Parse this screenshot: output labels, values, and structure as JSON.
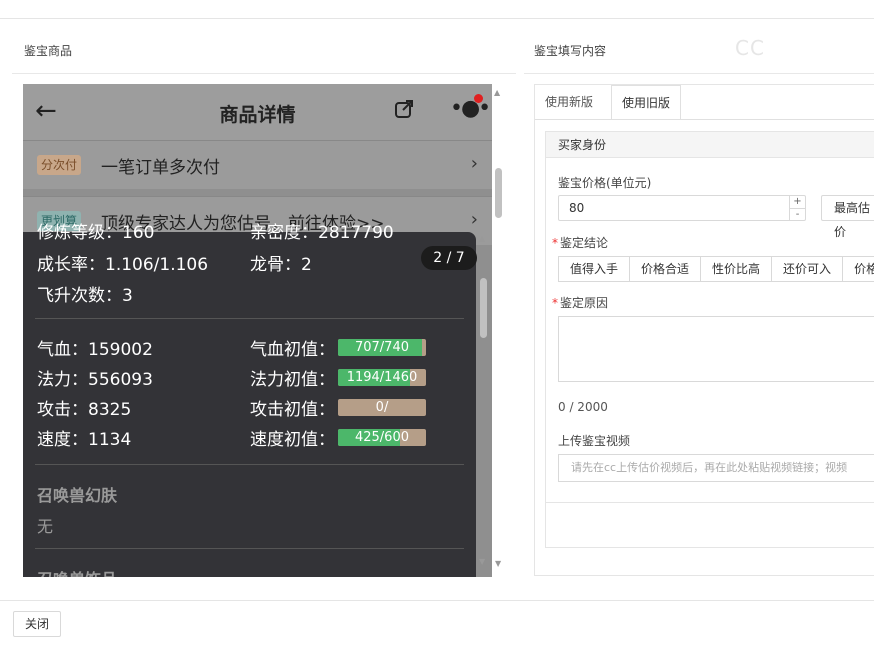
{
  "left_section": {
    "title": "鉴宝商品"
  },
  "right_section": {
    "title": "鉴宝填写内容"
  },
  "watermark": "CC",
  "phone": {
    "back_icon": "arrow-left-icon",
    "title": "商品详情",
    "share_icon": "share-icon",
    "more_icon": "more-icon",
    "rows": [
      {
        "tag": "分次付",
        "text": "一笔订单多次付"
      },
      {
        "tag": "更划算",
        "text": "顶级专家达人为您估号，前往体验>>"
      }
    ],
    "overlay": {
      "counter": "2 / 7",
      "cut_left": "修炼等级：160",
      "cut_right": "亲密度：2817790",
      "growth": "成长率：1.106/1.106",
      "dragon_bone": "龙骨：2",
      "ascend": "飞升次数：3",
      "stats": [
        {
          "label": "气血：159002",
          "init_label": "气血初值：",
          "bar": "707/740",
          "fill": 0.955
        },
        {
          "label": "法力：556093",
          "init_label": "法力初值：",
          "bar": "1194/1460",
          "fill": 0.818
        },
        {
          "label": "攻击：8325",
          "init_label": "攻击初值：",
          "bar": "0/",
          "fill": 0.0
        },
        {
          "label": "速度：1134",
          "init_label": "速度初值：",
          "bar": "425/600",
          "fill": 0.708
        }
      ],
      "skin_title": "召唤兽幻肤",
      "skin_value": "无",
      "decor_title": "召唤兽饰品"
    }
  },
  "panel": {
    "tabs": [
      {
        "label": "使用新版",
        "active": false
      },
      {
        "label": "使用旧版",
        "active": true
      }
    ],
    "buyer_identity": "买家身份",
    "price_label": "鉴宝价格(单位元)",
    "price_value": "80",
    "max_button": "最高估价",
    "conclusion_label": "鉴定结论",
    "conclusion_options": [
      "值得入手",
      "价格合适",
      "性价比高",
      "还价可入",
      "价格"
    ],
    "reason_label": "鉴定原因",
    "reason_count": "0 / 2000",
    "video_label": "上传鉴宝视频",
    "video_placeholder": "请先在cc上传估价视频后，再在此处粘贴视频链接；视频"
  },
  "footer": {
    "close_label": "关闭"
  }
}
